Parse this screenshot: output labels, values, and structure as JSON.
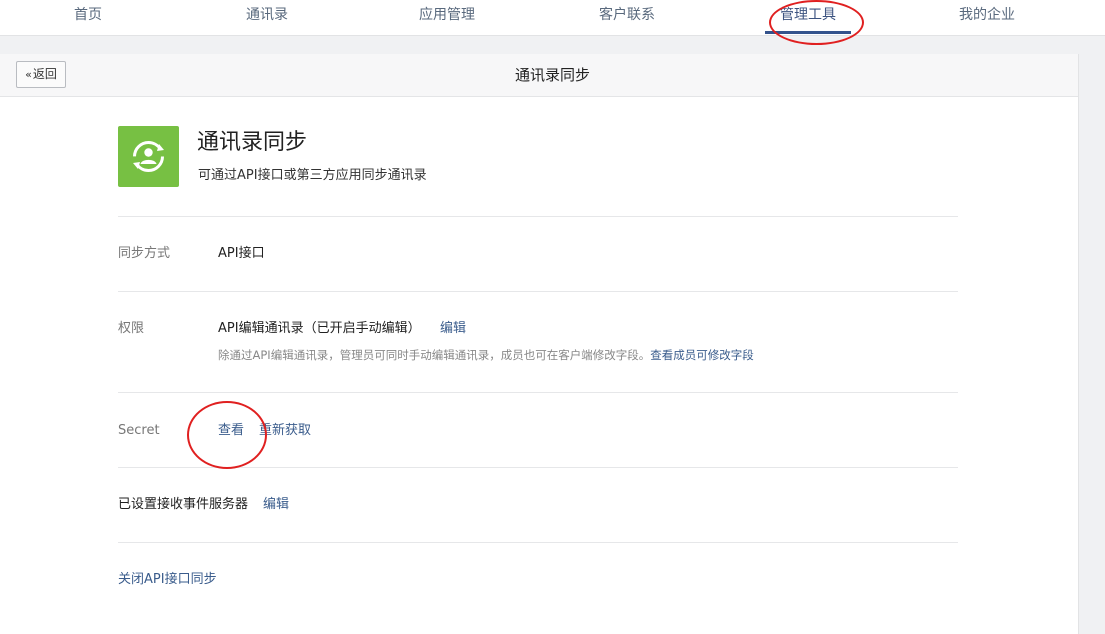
{
  "nav": {
    "items": [
      {
        "label": "首页"
      },
      {
        "label": "通讯录"
      },
      {
        "label": "应用管理"
      },
      {
        "label": "客户联系"
      },
      {
        "label": "管理工具"
      },
      {
        "label": "我的企业"
      }
    ],
    "active_index": 4
  },
  "header": {
    "back_label": "返回",
    "title": "通讯录同步"
  },
  "app": {
    "name": "通讯录同步",
    "description": "可通过API接口或第三方应用同步通讯录",
    "icon": "sync-user-icon",
    "icon_color": "#77c043"
  },
  "sync_method": {
    "label": "同步方式",
    "value": "API接口"
  },
  "permission": {
    "label": "权限",
    "value": "API编辑通讯录（已开启手动编辑）",
    "edit_label": "编辑",
    "hint": "除通过API编辑通讯录，管理员可同时手动编辑通讯录，成员也可在客户端修改字段。",
    "hint_link": "查看成员可修改字段"
  },
  "secret": {
    "label": "Secret",
    "view_label": "查看",
    "refresh_label": "重新获取"
  },
  "event_server": {
    "label": "已设置接收事件服务器",
    "edit_label": "编辑"
  },
  "close_link": "关闭API接口同步",
  "colors": {
    "link": "#3a5c8c",
    "nav_active_underline": "#34538c",
    "annotation": "#e02020"
  }
}
